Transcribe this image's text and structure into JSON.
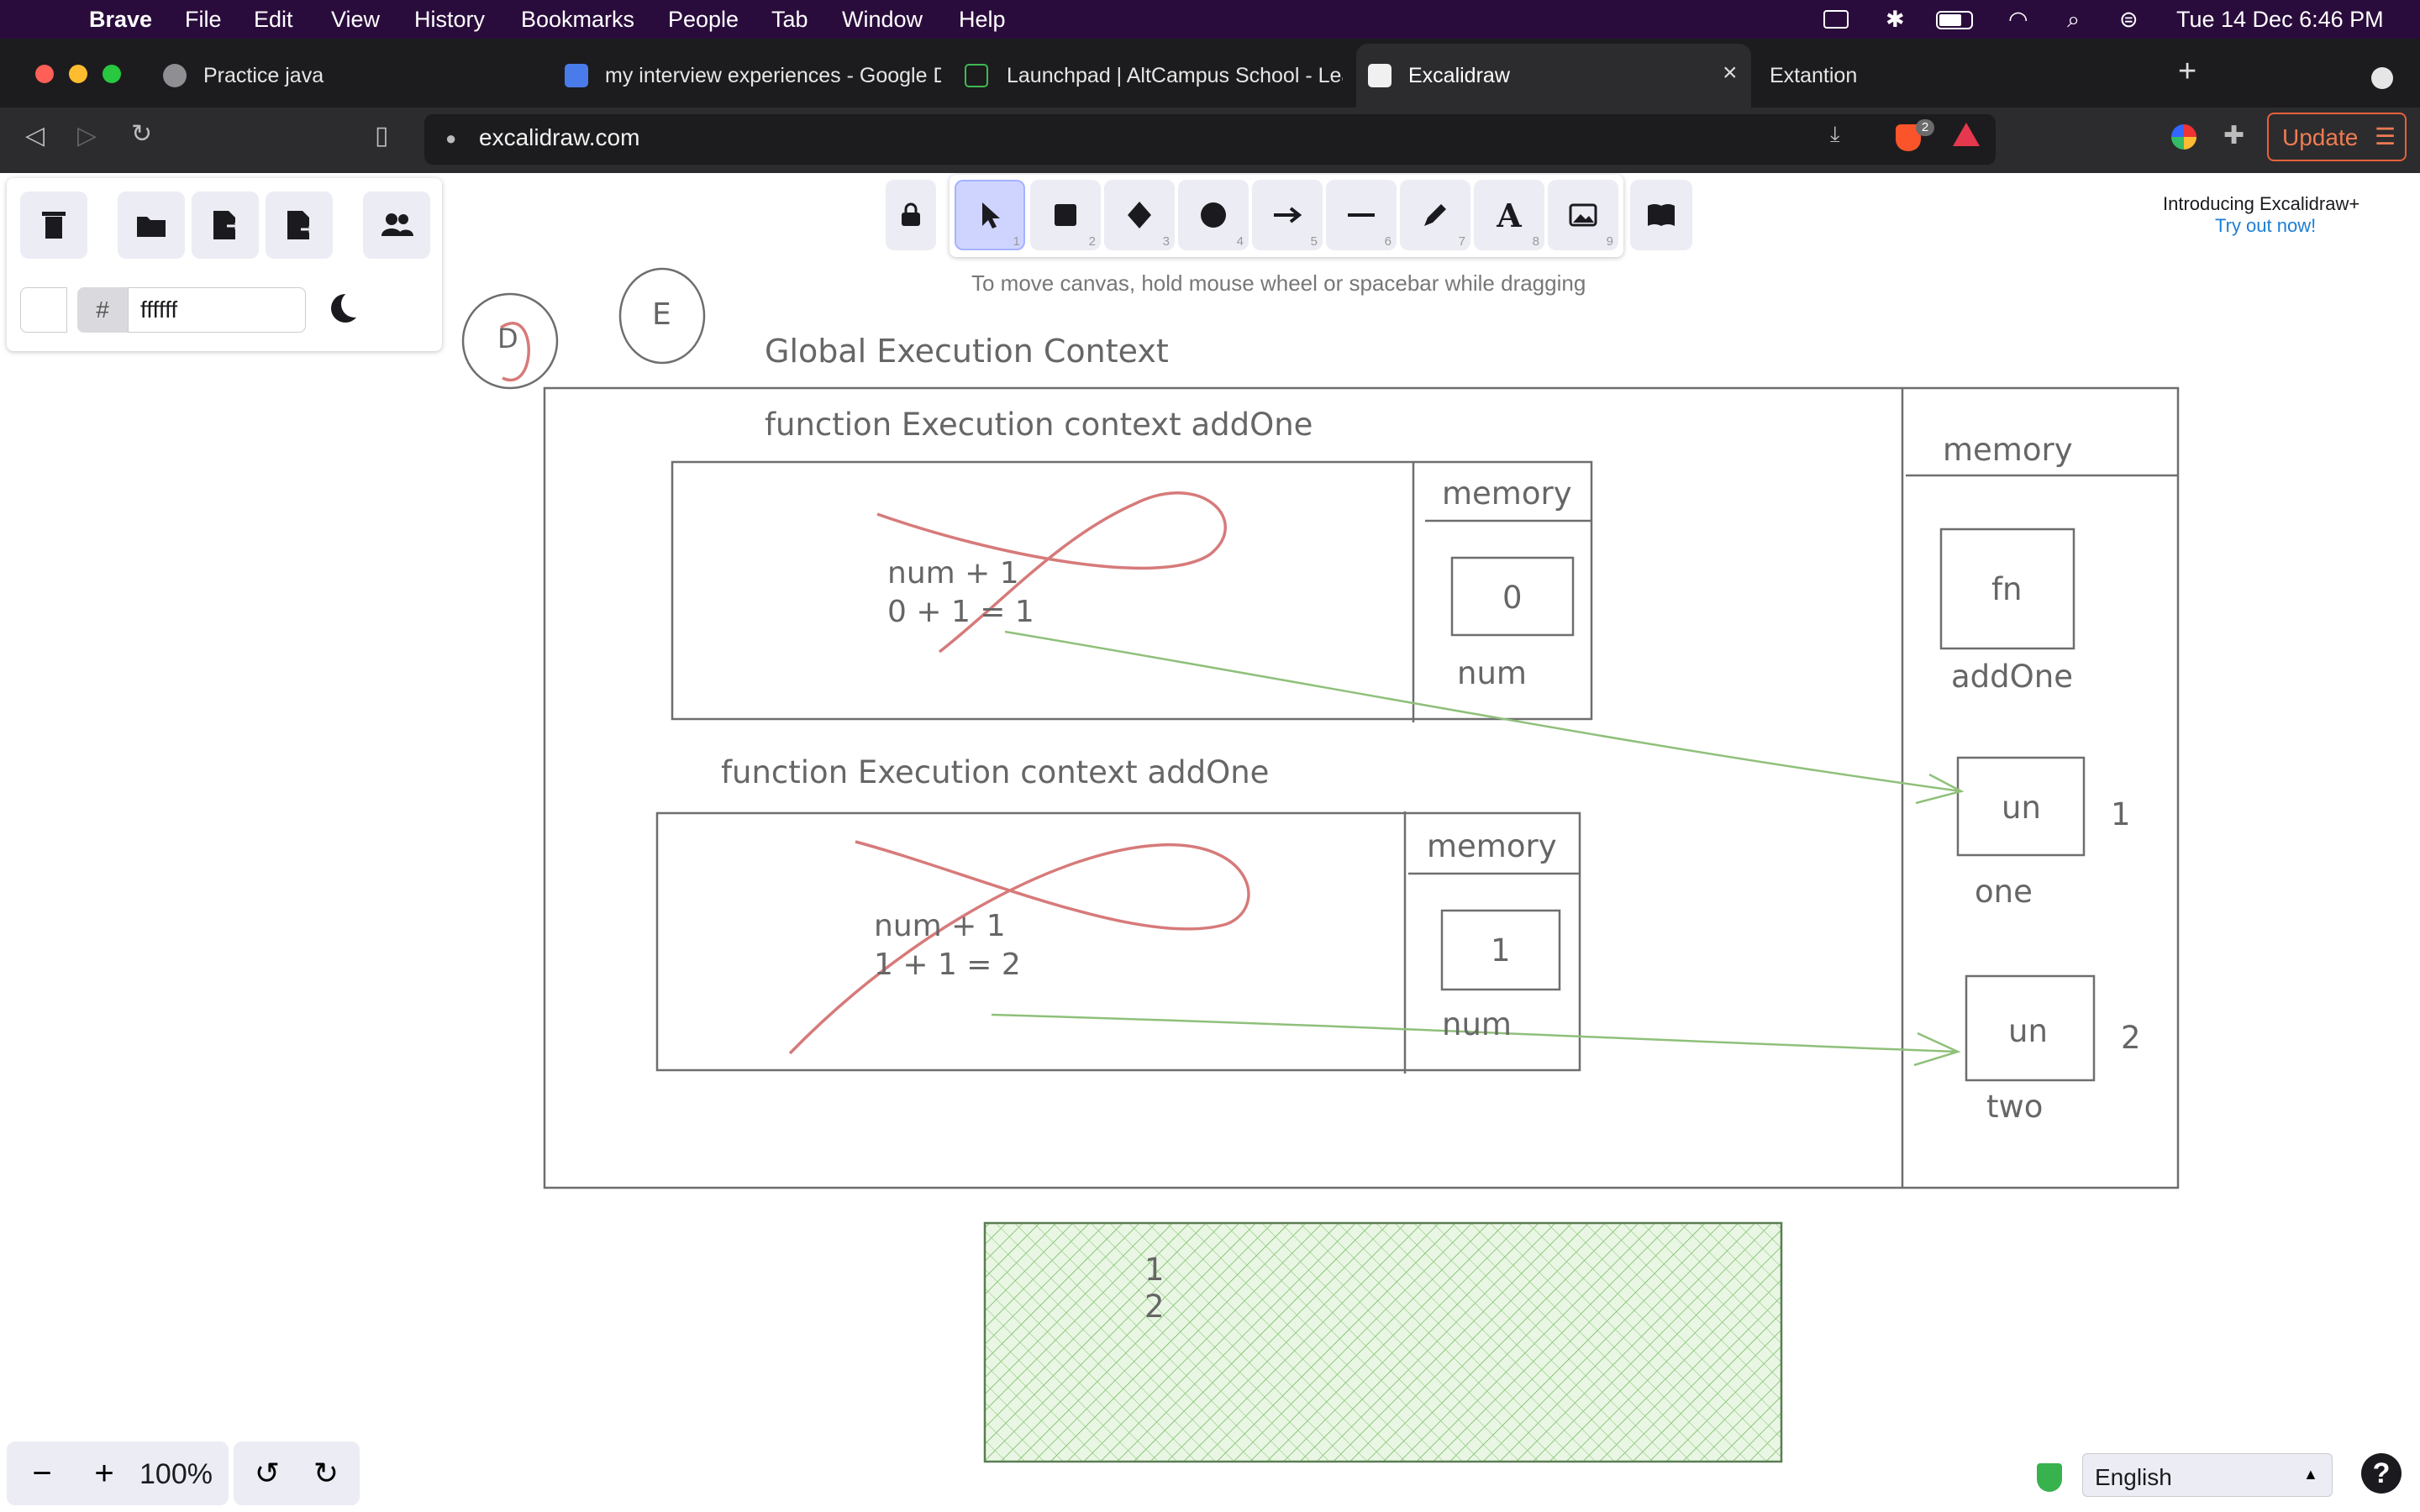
{
  "menubar": {
    "app_name": "Brave",
    "items": [
      "File",
      "Edit",
      "View",
      "History",
      "Bookmarks",
      "People",
      "Tab",
      "Window",
      "Help"
    ],
    "datetime": "Tue 14 Dec  6:46 PM"
  },
  "tabs": [
    {
      "title": "Practice java"
    },
    {
      "title": "my interview experiences - Google Docs"
    },
    {
      "title": "Launchpad | AltCampus School - Learn"
    },
    {
      "title": "Excalidraw"
    },
    {
      "title": "Extantion"
    }
  ],
  "toolbar": {
    "url": "excalidraw.com",
    "update_label": "Update",
    "brave_badge": "2"
  },
  "excalidraw": {
    "color_hash": "#",
    "color_value": "ffffff",
    "hint": "To move canvas, hold mouse wheel or spacebar while dragging",
    "promo_title": "Introducing Excalidraw+",
    "promo_link": "Try out now!",
    "zoom": "100%",
    "language": "English",
    "help": "?",
    "tools": [
      {
        "name": "selection",
        "key": "1"
      },
      {
        "name": "rectangle",
        "key": "2"
      },
      {
        "name": "diamond",
        "key": "3"
      },
      {
        "name": "ellipse",
        "key": "4"
      },
      {
        "name": "arrow",
        "key": "5"
      },
      {
        "name": "line",
        "key": "6"
      },
      {
        "name": "draw",
        "key": "7"
      },
      {
        "name": "text",
        "key": "8"
      },
      {
        "name": "image",
        "key": "9"
      }
    ]
  },
  "drawing": {
    "circle_d": "D",
    "circle_e": "E",
    "global_title": "Global Execution Context",
    "fec1_title": "function Execution context addOne",
    "fec1_line1": "num + 1",
    "fec1_line2": "0 + 1 = 1",
    "fec1_memory": "memory",
    "fec1_value": "0",
    "fec1_var": "num",
    "fec2_title": "function Execution context addOne",
    "fec2_line1": "num + 1",
    "fec2_line2": "1 + 1 = 2",
    "fec2_memory": "memory",
    "fec2_value": "1",
    "fec2_var": "num",
    "global_memory": "memory",
    "fn_box": "fn",
    "fn_var": "addOne",
    "one_box": "un",
    "one_value": "1",
    "one_var": "one",
    "two_box": "un",
    "two_value": "2",
    "two_var": "two",
    "console_line1": "1",
    "console_line2": "2"
  }
}
